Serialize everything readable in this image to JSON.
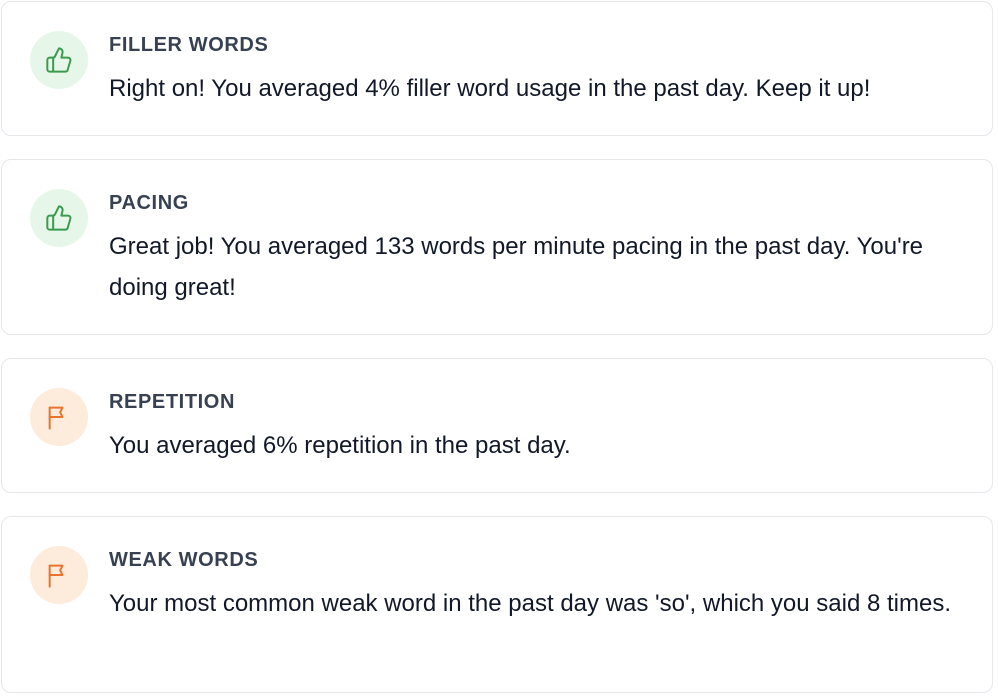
{
  "colors": {
    "positive_icon": "#3c9a4e",
    "positive_bg": "#e6f7ea",
    "attention_icon": "#e8742f",
    "attention_bg": "#fdecdc",
    "card_border": "#e5e7eb"
  },
  "cards": [
    {
      "icon": "thumbs-up-icon",
      "status": "positive",
      "title": "FILLER WORDS",
      "message": "Right on! You averaged 4% filler word usage in the past day. Keep it up!"
    },
    {
      "icon": "thumbs-up-icon",
      "status": "positive",
      "title": "PACING",
      "message": "Great job! You averaged 133 words per minute pacing in the past day. You're doing great!"
    },
    {
      "icon": "flag-icon",
      "status": "attention",
      "title": "REPETITION",
      "message": "You averaged 6% repetition in the past day."
    },
    {
      "icon": "flag-icon",
      "status": "attention",
      "title": "WEAK WORDS",
      "message": "Your most common weak word in the past day was 'so', which you said 8 times."
    }
  ]
}
